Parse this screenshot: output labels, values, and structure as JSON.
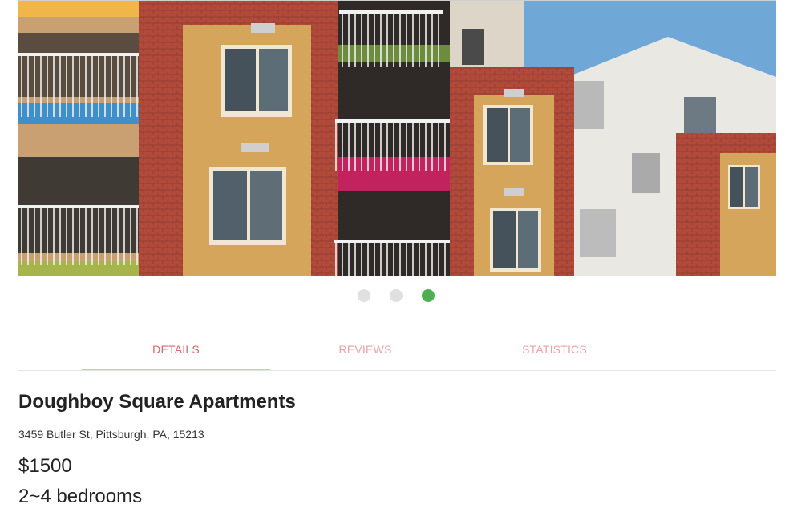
{
  "carousel": {
    "image_alt": "Doughboy Square Apartments building photo",
    "dot_count": 3,
    "active_index": 2,
    "colors": {
      "dot_inactive": "#e0e0e0",
      "dot_active": "#4caf50"
    }
  },
  "tabs": [
    {
      "label": "DETAILS",
      "active": true
    },
    {
      "label": "REVIEWS",
      "active": false
    },
    {
      "label": "STATISTICS",
      "active": false
    }
  ],
  "listing": {
    "name": "Doughboy Square Apartments",
    "address": "3459 Butler St, Pittsburgh, PA, 15213",
    "price": "$1500",
    "bedrooms": "2~4 bedrooms"
  },
  "colors": {
    "tab_active": "#d9666f",
    "tab_inactive": "#e9a3a3",
    "tab_indicator": "#f0b7b7"
  }
}
